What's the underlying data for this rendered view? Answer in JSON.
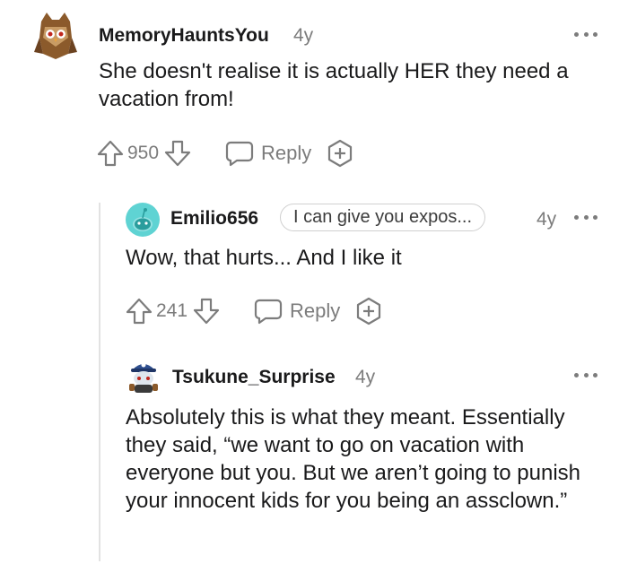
{
  "comments": [
    {
      "username": "MemoryHauntsYou",
      "age": "4y",
      "text": "She doesn't realise it is actually HER they need a vacation from!",
      "votes": "950",
      "reply_label": "Reply",
      "avatar_icon": "owl-avatar-icon"
    },
    {
      "username": "Emilio656",
      "flair": "I can give you expos...",
      "age": "4y",
      "text": "Wow, that hurts... And I like it",
      "votes": "241",
      "reply_label": "Reply",
      "avatar_icon": "snoo-avatar-icon"
    },
    {
      "username": "Tsukune_Surprise",
      "age": "4y",
      "text": "Absolutely this is what they meant. Essentially they said, “we want to go on vacation with everyone but you. But we aren’t going to punish your innocent kids for you being an assclown.”",
      "avatar_icon": "snoo-cap-avatar-icon"
    }
  ],
  "colors": {
    "meta_gray": "#7c7c7c",
    "text": "#1a1a1b",
    "teal_avatar": "#5fd3d3",
    "thread_line": "#e2e2e2"
  }
}
